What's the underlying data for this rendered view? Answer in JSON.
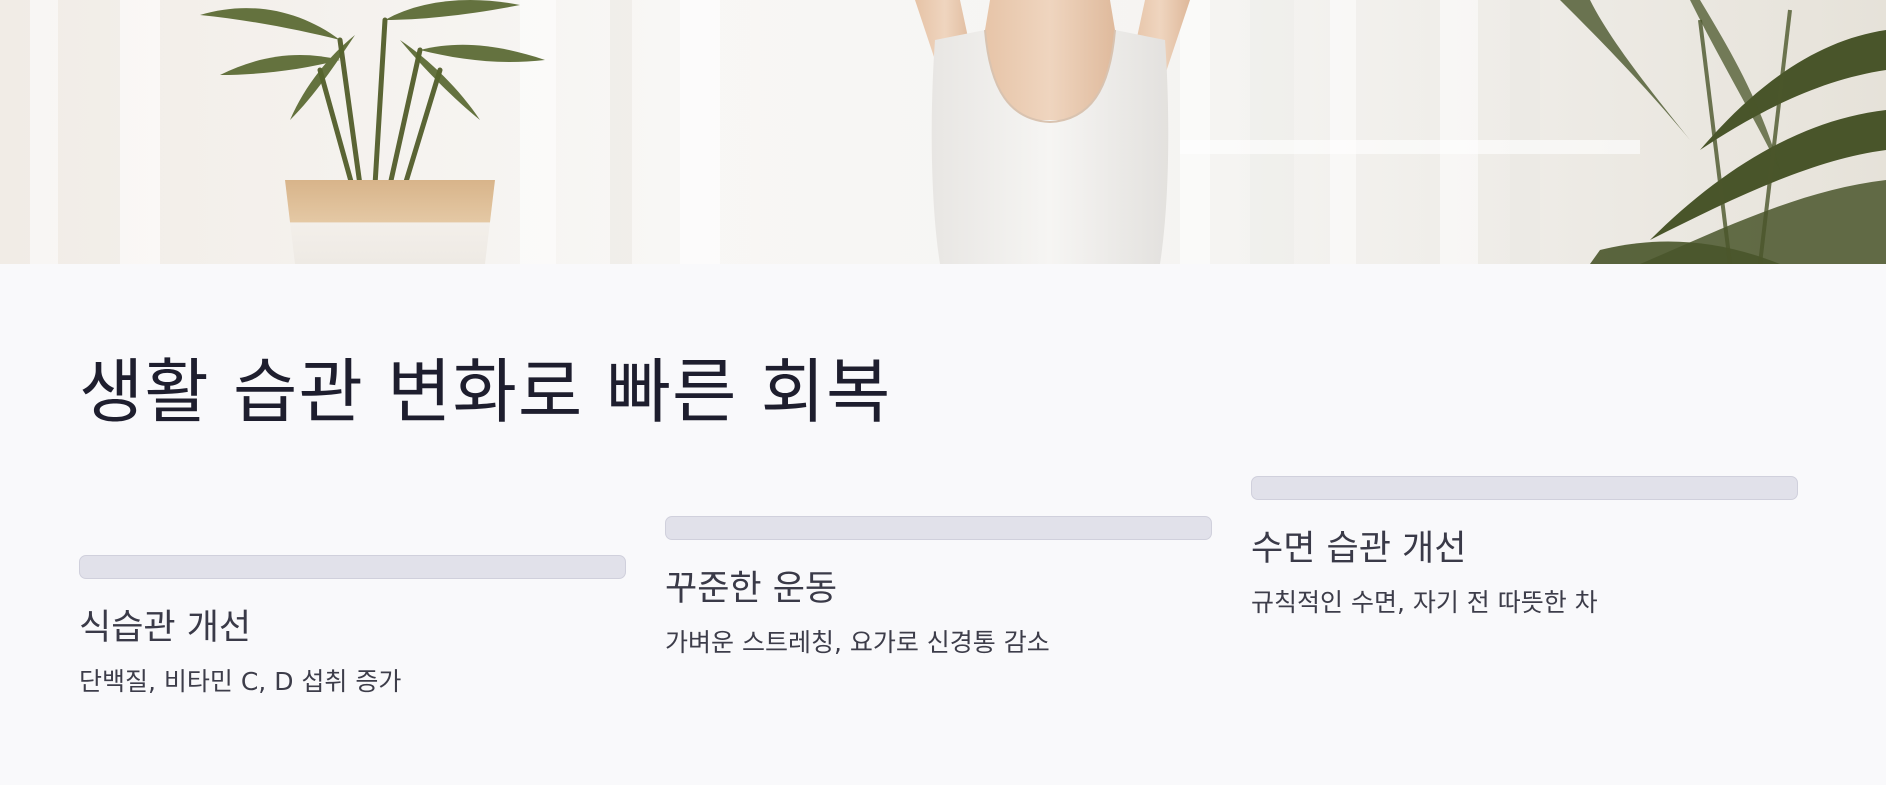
{
  "hero": {
    "image": "yoga-woman-stretching-with-plants-photo",
    "colors": {
      "curtain": "#f5f4f1",
      "skin": "#e8c9ae",
      "tanktop": "#f2f1ef",
      "plant": "#4f5a2e",
      "pot": "#d9c0a0"
    }
  },
  "page": {
    "title": "생활 습관 변화로 빠른 회복"
  },
  "cards": [
    {
      "title": "식습관 개선",
      "description": "단백질, 비타민 C, D 섭취 증가"
    },
    {
      "title": "꾸준한 운동",
      "description": "가벼운 스트레칭, 요가로 신경통 감소"
    },
    {
      "title": "수면 습관 개선",
      "description": "규칙적인 수면, 자기 전 따뜻한 차"
    }
  ],
  "colors": {
    "background": "#f9f9fb",
    "title_text": "#1e1e2e",
    "bar_fill": "#e1e1ea",
    "bar_border": "#d0d0dc"
  }
}
